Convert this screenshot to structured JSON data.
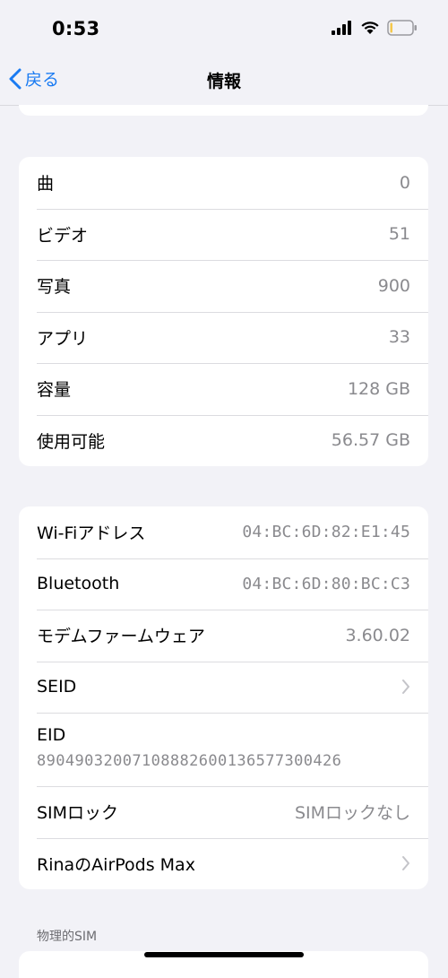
{
  "status": {
    "time": "0:53"
  },
  "nav": {
    "back_label": "戻る",
    "title": "情報"
  },
  "media_group": [
    {
      "label": "曲",
      "value": "0"
    },
    {
      "label": "ビデオ",
      "value": "51"
    },
    {
      "label": "写真",
      "value": "900"
    },
    {
      "label": "アプリ",
      "value": "33"
    },
    {
      "label": "容量",
      "value": "128 GB"
    },
    {
      "label": "使用可能",
      "value": "56.57 GB"
    }
  ],
  "network_group": {
    "wifi": {
      "label": "Wi-Fiアドレス",
      "value": "04:BC:6D:82:E1:45"
    },
    "bluetooth": {
      "label": "Bluetooth",
      "value": "04:BC:6D:80:BC:C3"
    },
    "modem": {
      "label": "モデムファームウェア",
      "value": "3.60.02"
    },
    "seid": {
      "label": "SEID"
    },
    "eid": {
      "label": "EID",
      "value": "89049032007108882600136577300426"
    },
    "simlock": {
      "label": "SIMロック",
      "value": "SIMロックなし"
    },
    "airpods": {
      "label": "RinaのAirPods Max"
    }
  },
  "physical_sim_header": "物理的SIM",
  "colors": {
    "accent": "#1a7bf2",
    "background": "#f2f2f7",
    "secondary_text": "#8a8a8e"
  }
}
